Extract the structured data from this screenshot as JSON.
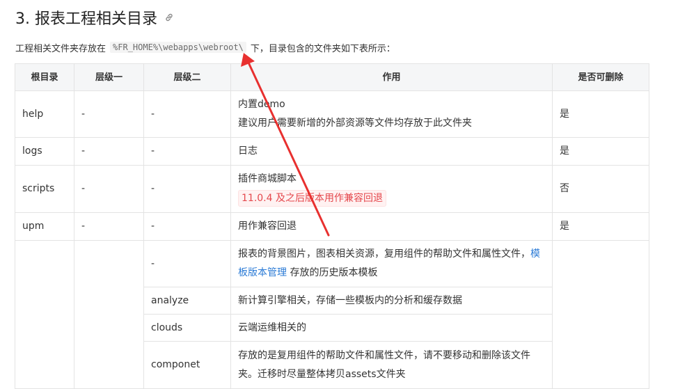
{
  "heading": {
    "text": "3. 报表工程相关目录"
  },
  "intro": {
    "before": "工程相关文件夹存放在",
    "path": "%FR_HOME%\\webapps\\webroot\\",
    "after": "下，目录包含的文件夹如下表所示："
  },
  "table": {
    "headers": {
      "root": "根目录",
      "level1": "层级一",
      "level2": "层级二",
      "use": "作用",
      "deletable": "是否可删除"
    },
    "rows": {
      "help": {
        "root": "help",
        "l1": "-",
        "l2": "-",
        "use1": "内置demo",
        "use2": "建议用户需要新增的外部资源等文件均存放于此文件夹",
        "del": "是"
      },
      "logs": {
        "root": "logs",
        "l1": "-",
        "l2": "-",
        "use": "日志",
        "del": "是"
      },
      "scripts": {
        "root": "scripts",
        "l1": "-",
        "l2": "-",
        "use1": "插件商城脚本",
        "use_tag": "11.0.4 及之后版本用作兼容回退",
        "del": "否"
      },
      "upm": {
        "root": "upm",
        "l1": "-",
        "l2": "-",
        "use": "用作兼容回退",
        "del": "是"
      },
      "assets": {
        "sub_dash": {
          "l2": "-",
          "use_pre": "报表的背景图片，图表相关资源，复用组件的帮助文件和属性文件，",
          "use_link": "模板版本管理",
          "use_post": "存放的历史版本模板"
        },
        "analyze": {
          "l2": "analyze",
          "use": "新计算引擎相关，存储一些模板内的分析和缓存数据"
        },
        "clouds": {
          "l2": "clouds",
          "use": "云端运维相关的"
        },
        "componet": {
          "l2": "componet",
          "use": "存放的是复用组件的帮助文件和属性文件，请不要移动和删除该文件夹。迁移时尽量整体拷贝assets文件夹"
        }
      }
    }
  },
  "colors": {
    "arrow": "#e8302f",
    "tag_text": "#e5484d",
    "link": "#2b7bd6",
    "header_bg": "#f5f6f7"
  },
  "icons": {
    "anchor": "link-icon"
  }
}
